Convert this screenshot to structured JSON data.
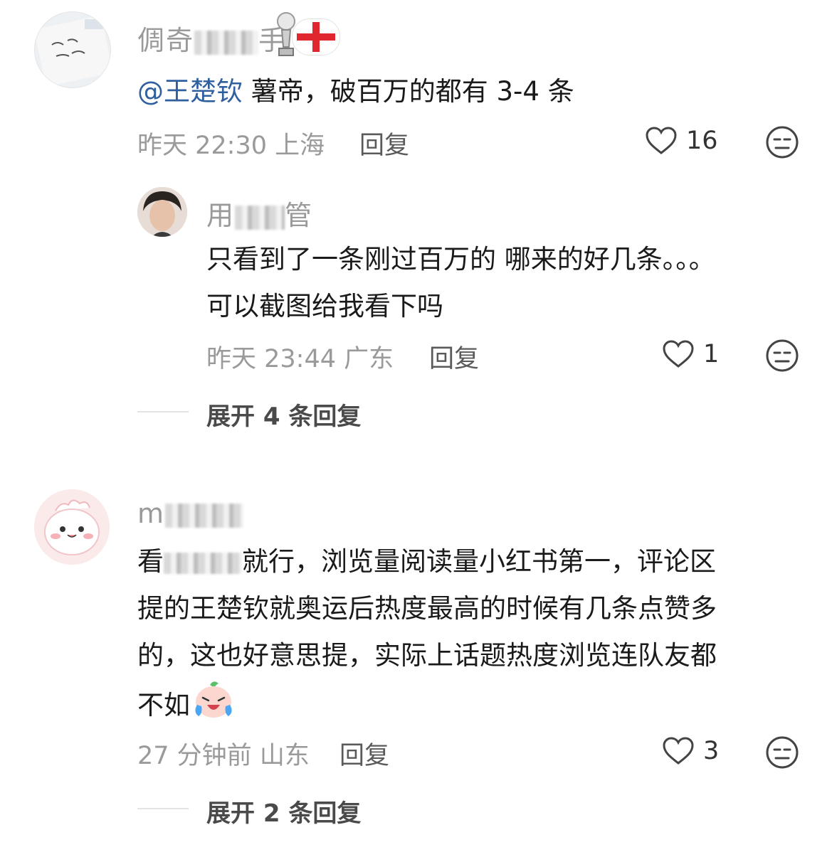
{
  "comments": [
    {
      "username_visible": "倜奇",
      "username_tail": "手",
      "mention": "@王楚钦",
      "text": " 薯帝，破百万的都有 3-4 条",
      "time": "昨天 22:30",
      "location": "上海",
      "reply_label": "回复",
      "likes": "16",
      "replies": [
        {
          "username_visible": "用",
          "username_tail": "管",
          "line1": "只看到了一条刚过百万的 哪来的好几条。。。",
          "line2": "可以截图给我看下吗",
          "time": "昨天 23:44",
          "location": "广东",
          "reply_label": "回复",
          "likes": "1"
        }
      ],
      "expand": "展开 4 条回复"
    },
    {
      "username_visible": "m",
      "username_tail": "",
      "line1_head": "看",
      "line1_tail": "就行，浏览量阅读量小红书第一，评论区",
      "line2": "提的王楚钦就奥运后热度最高的时候有几条点赞多",
      "line3": "的，这也好意思提，实际上话题热度浏览连队友都",
      "line4": "不如",
      "time": "27 分钟前",
      "location": "山东",
      "reply_label": "回复",
      "likes": "3",
      "expand": "展开 2 条回复"
    }
  ]
}
